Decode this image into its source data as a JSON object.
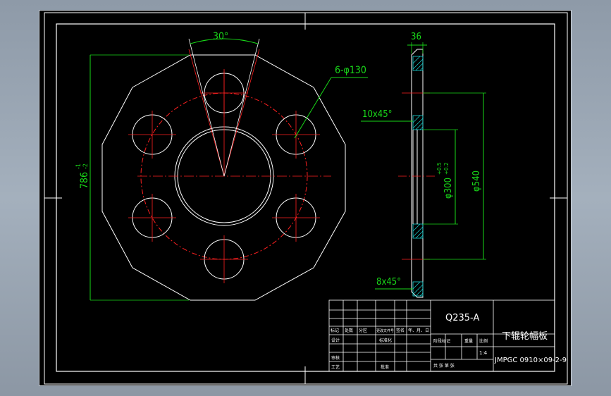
{
  "dimensions": {
    "angle": "30°",
    "holes": "6-φ130",
    "chamfer_top": "10x45°",
    "chamfer_bottom": "8x45°",
    "thickness": "36",
    "height": "786",
    "height_tol": "-1",
    "height_tol2": "-2",
    "bore": "φ300",
    "bore_tol_upper": "+0.5",
    "bore_tol_lower": "+0.2",
    "pitch": "φ540"
  },
  "title_block": {
    "material": "Q235-A",
    "part_name": "下辊轮幅板",
    "drawing_no": "JMPGC 0910×09-2-9",
    "scale": "1:4",
    "row_labels": [
      "标记",
      "处数",
      "分区",
      "更改文件号",
      "签名",
      "年、月、日"
    ],
    "design_label": "设计",
    "standard_label": "标准化",
    "review_label": "审核",
    "process_label": "工艺",
    "approve_label": "批准",
    "stage_label": "阶段标记",
    "weight_label": "重量",
    "ratio_label": "比例",
    "sheet_label": "共  张  第  张"
  }
}
